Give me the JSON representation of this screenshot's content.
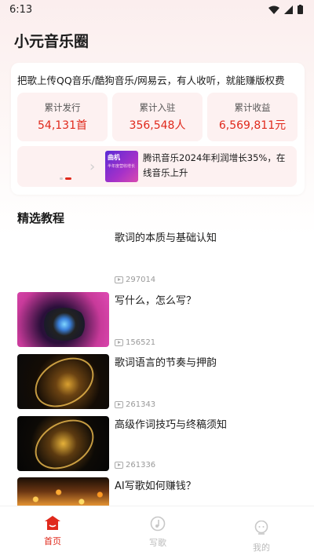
{
  "status_bar": {
    "time": "6:13"
  },
  "app": {
    "title": "小元音乐圈"
  },
  "promo": {
    "text": "把歌上传QQ音乐/酷狗音乐/网易云，有人收听，就能赚版权费"
  },
  "stats": [
    {
      "label": "累计发行",
      "value": "54,131首"
    },
    {
      "label": "累计入驻",
      "value": "356,548人"
    },
    {
      "label": "累计收益",
      "value": "6,569,811元"
    }
  ],
  "news": {
    "thumb_title": "曲机",
    "thumb_sub": "半年度营收增长",
    "text": "腾讯音乐2024年利润增长35%，在线音乐上升"
  },
  "section": {
    "title": "精选教程"
  },
  "tutorials": [
    {
      "title": "歌词的本质与基础认知",
      "views": "297014"
    },
    {
      "title": "写什么，怎么写？",
      "views": "156521"
    },
    {
      "title": "歌词语言的节奏与押韵",
      "views": "261343"
    },
    {
      "title": "高级作词技巧与终稿须知",
      "views": "261336"
    },
    {
      "title": "AI写歌如何赚钱？",
      "views": ""
    }
  ],
  "tabs": [
    {
      "label": "首页",
      "icon": "home-icon",
      "active": true
    },
    {
      "label": "写歌",
      "icon": "music-note-icon",
      "active": false
    },
    {
      "label": "我的",
      "icon": "profile-icon",
      "active": false
    }
  ],
  "colors": {
    "accent": "#e0291c",
    "stat_bg": "#fdf1f1",
    "inactive": "#bbbbbb"
  }
}
